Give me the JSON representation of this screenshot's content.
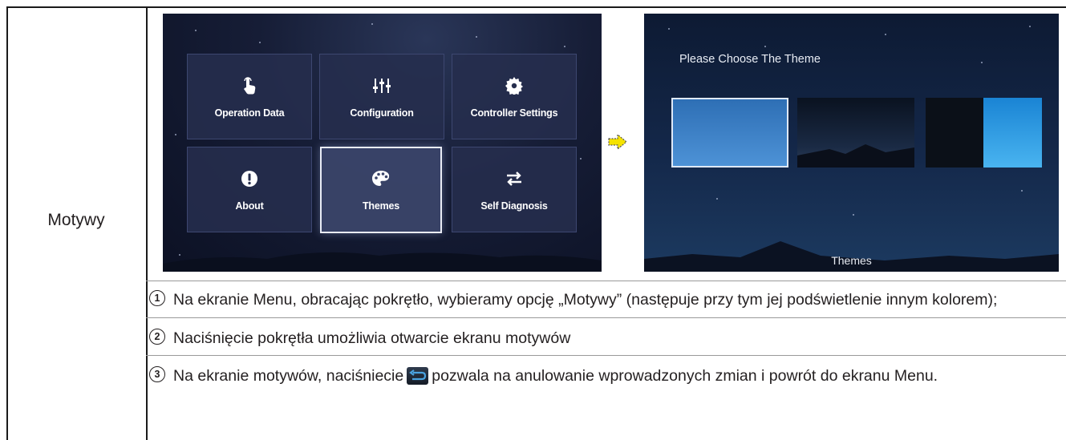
{
  "row_label": "Motywy",
  "menu": {
    "tiles": [
      {
        "label": "Operation Data",
        "icon": "touch-hand-icon"
      },
      {
        "label": "Configuration",
        "icon": "sliders-icon"
      },
      {
        "label": "Controller Settings",
        "icon": "gear-icon"
      },
      {
        "label": "About",
        "icon": "exclamation-icon"
      },
      {
        "label": "Themes",
        "icon": "palette-icon",
        "selected": true
      },
      {
        "label": "Self Diagnosis",
        "icon": "swap-arrows-icon"
      }
    ]
  },
  "themes_screen": {
    "title": "Please Choose The Theme",
    "caption": "Themes"
  },
  "steps": [
    {
      "num": "1",
      "text": "Na ekranie Menu, obracając pokrętło, wybieramy opcję „Motywy” (następuje przy tym jej podświetlenie innym kolorem);"
    },
    {
      "num": "2",
      "text": "Naciśnięcie pokrętła umożliwia otwarcie ekranu motywów"
    },
    {
      "num": "3",
      "text_before": "Na ekranie motywów, naciśniecie",
      "text_after": "pozwala na anulowanie wprowadzonych zmian i powrót do ekranu Menu."
    }
  ],
  "colors": {
    "arrow_fill": "#f5e300",
    "selection_border": "#e9ecf5",
    "accent_blue": "#4aa3e0"
  }
}
